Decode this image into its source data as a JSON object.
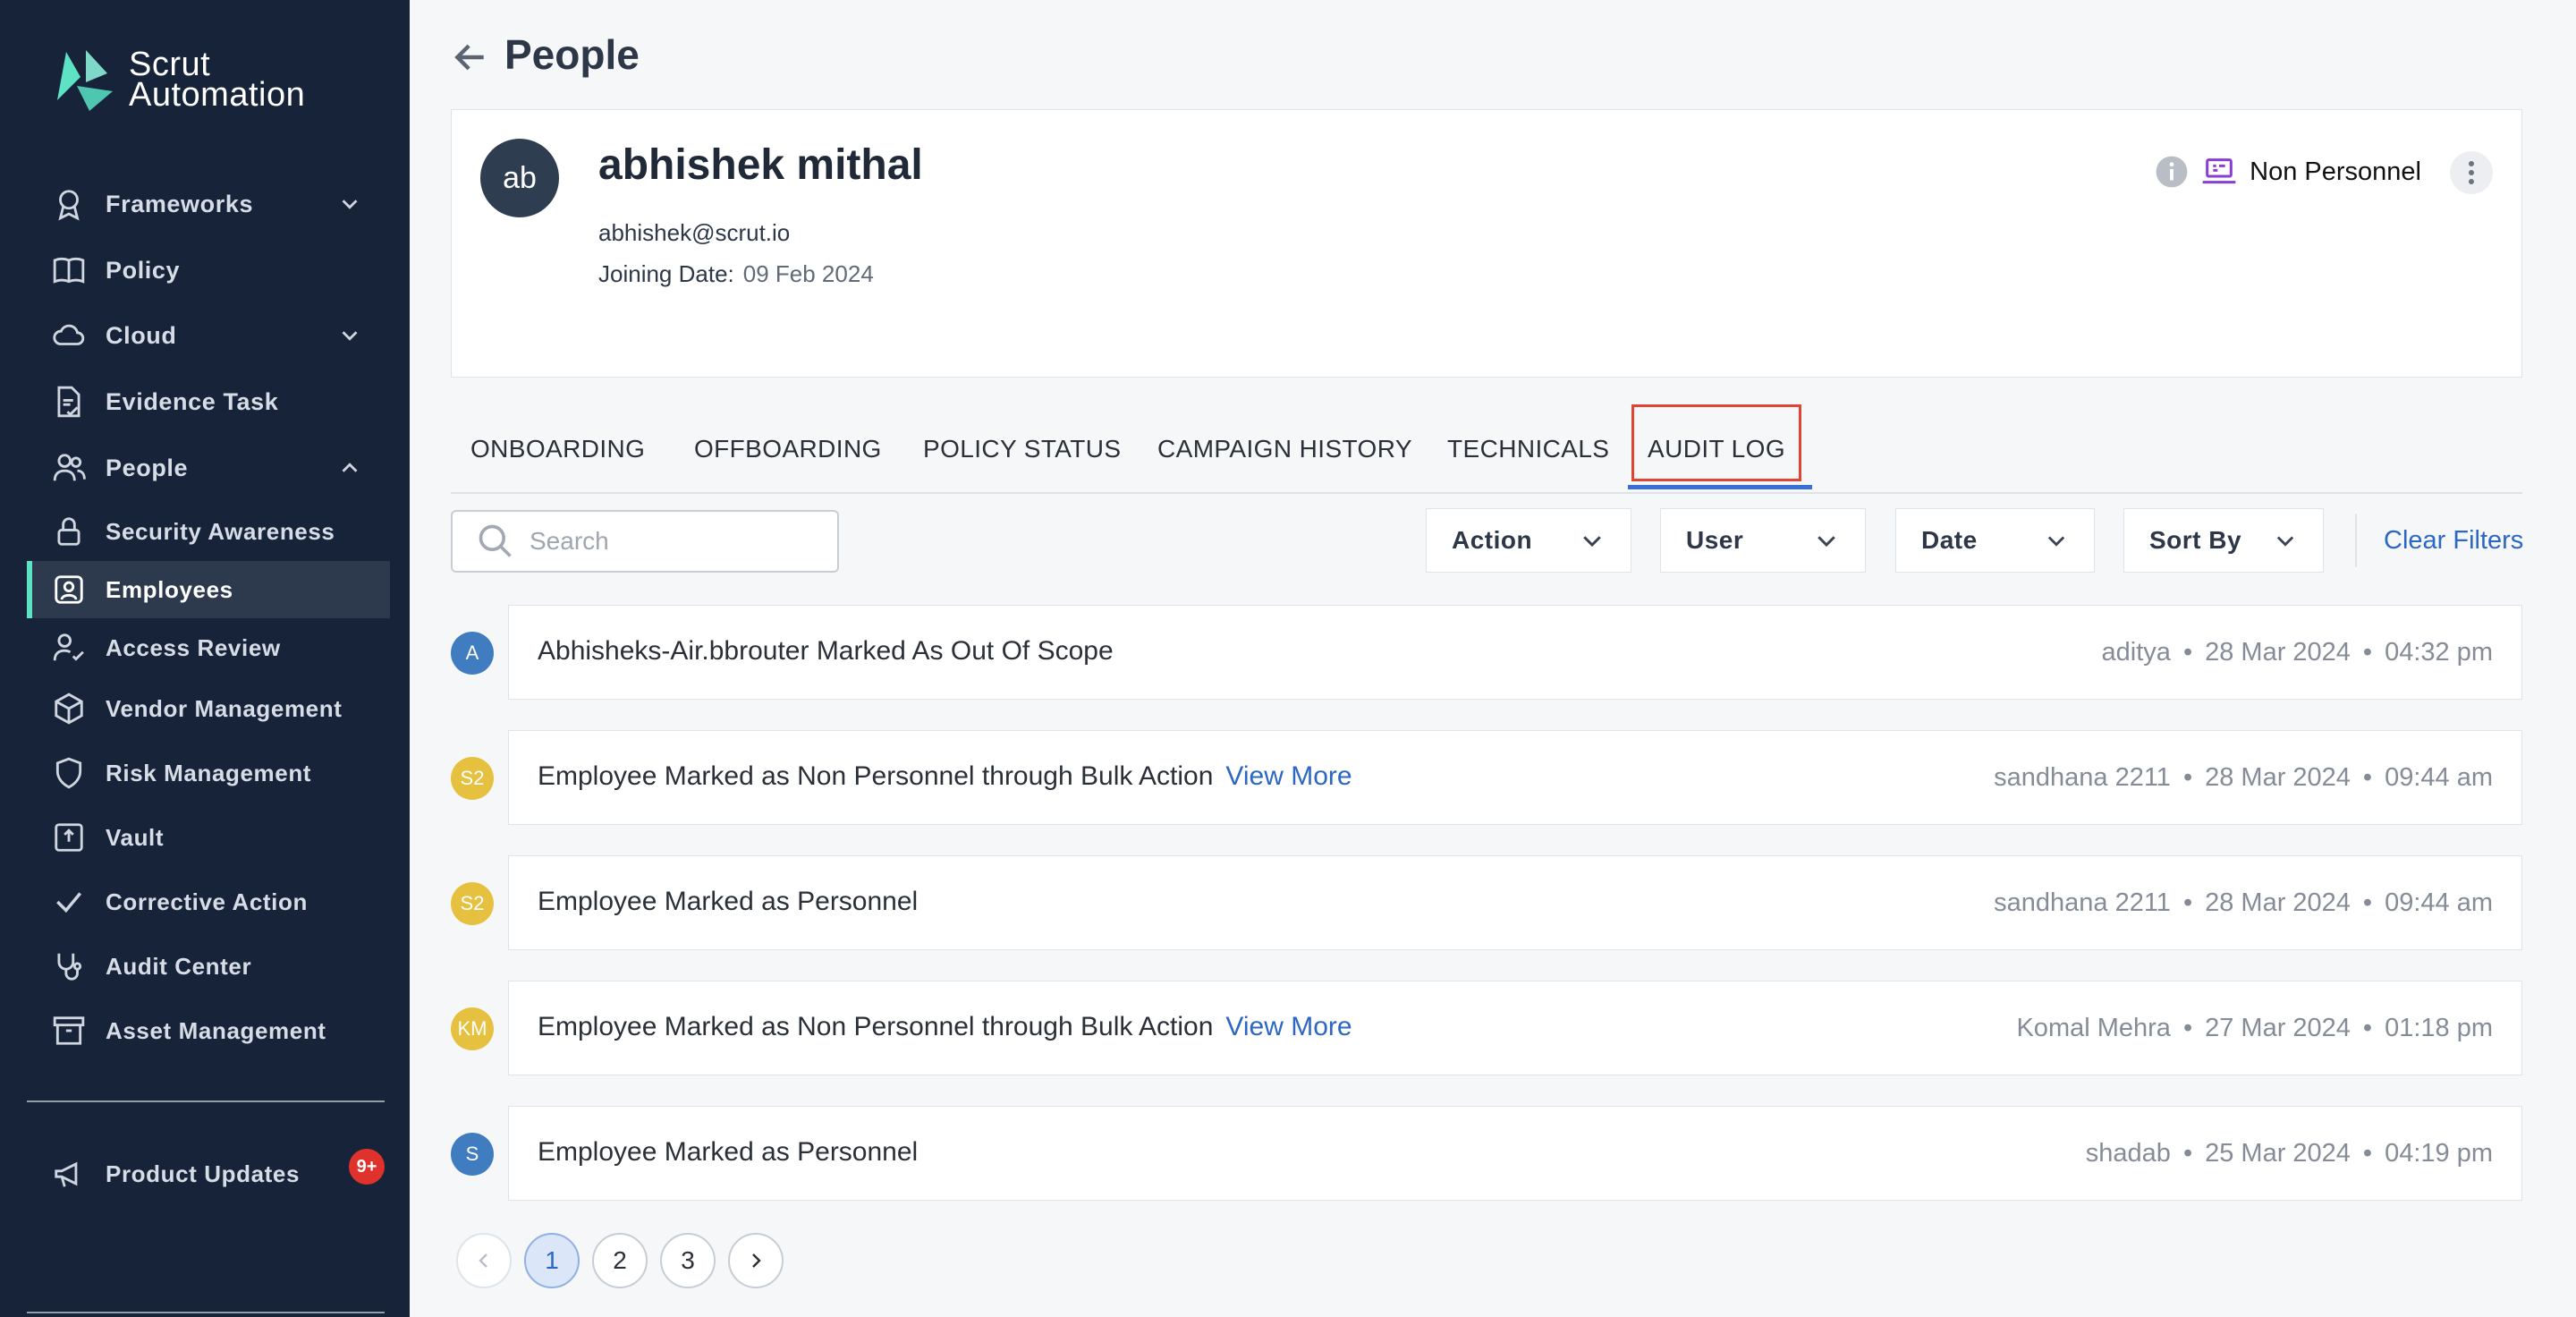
{
  "app": {
    "logo_line1": "Scrut",
    "logo_line2": "Automation"
  },
  "sidebar": {
    "items": [
      {
        "label": "Frameworks",
        "icon": "award-icon"
      },
      {
        "label": "Policy",
        "icon": "book-icon"
      },
      {
        "label": "Cloud",
        "icon": "cloud-icon"
      },
      {
        "label": "Evidence Task",
        "icon": "document-check-icon"
      },
      {
        "label": "People",
        "icon": "users-icon"
      },
      {
        "label": "Security Awareness",
        "icon": "lock-icon"
      },
      {
        "label": "Employees",
        "icon": "id-badge-icon"
      },
      {
        "label": "Access Review",
        "icon": "user-check-icon"
      },
      {
        "label": "Vendor Management",
        "icon": "box-icon"
      },
      {
        "label": "Risk Management",
        "icon": "shield-icon"
      },
      {
        "label": "Vault",
        "icon": "vault-icon"
      },
      {
        "label": "Corrective Action",
        "icon": "check-icon"
      },
      {
        "label": "Audit Center",
        "icon": "stethoscope-icon"
      },
      {
        "label": "Asset Management",
        "icon": "archive-icon"
      }
    ],
    "product_updates": {
      "label": "Product Updates",
      "badge": "9+"
    }
  },
  "header": {
    "title": "People"
  },
  "profile": {
    "initials": "ab",
    "name": "abhishek mithal",
    "email": "abhishek@scrut.io",
    "joining_label": "Joining Date:",
    "joining_date": "09 Feb 2024",
    "type": "Non Personnel"
  },
  "tabs": [
    "ONBOARDING",
    "OFFBOARDING",
    "POLICY STATUS",
    "CAMPAIGN HISTORY",
    "TECHNICALS",
    "AUDIT LOG"
  ],
  "filters": {
    "search_placeholder": "Search",
    "action": "Action",
    "user": "User",
    "date": "Date",
    "sort": "Sort By",
    "clear": "Clear Filters"
  },
  "log": [
    {
      "initials": "A",
      "color": "#3f7cc0",
      "text": "Abhisheks-Air.bbrouter Marked As Out Of Scope",
      "link": "",
      "user": "aditya",
      "date": "28 Mar 2024",
      "time": "04:32 pm"
    },
    {
      "initials": "S2",
      "color": "#e6c140",
      "text": "Employee Marked as Non Personnel through Bulk Action",
      "link": "View More",
      "user": "sandhana 2211",
      "date": "28 Mar 2024",
      "time": "09:44 am"
    },
    {
      "initials": "S2",
      "color": "#e6c140",
      "text": "Employee Marked as Personnel",
      "link": "",
      "user": "sandhana 2211",
      "date": "28 Mar 2024",
      "time": "09:44 am"
    },
    {
      "initials": "KM",
      "color": "#e6c140",
      "text": "Employee Marked as Non Personnel through Bulk Action",
      "link": "View More",
      "user": "Komal Mehra",
      "date": "27 Mar 2024",
      "time": "01:18 pm"
    },
    {
      "initials": "S",
      "color": "#3f7cc0",
      "text": "Employee Marked as Personnel",
      "link": "",
      "user": "shadab",
      "date": "25 Mar 2024",
      "time": "04:19 pm"
    }
  ],
  "meta_separator": "•",
  "pagination": {
    "pages": [
      "1",
      "2",
      "3"
    ],
    "current": "1"
  }
}
